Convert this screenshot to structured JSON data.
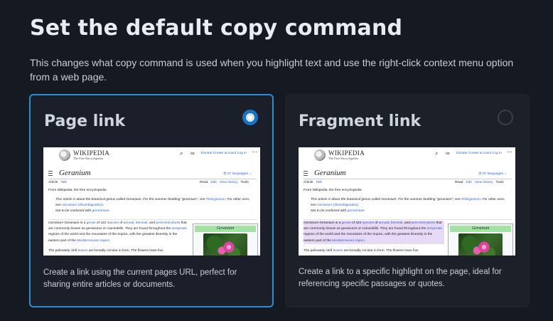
{
  "page": {
    "title": "Set the default copy command",
    "subtitle": "This changes what copy command is used when you highlight text and use the right-click context menu option from a web page."
  },
  "options": [
    {
      "title": "Page link",
      "selected": true,
      "description": "Create a link using the current pages URL, perfect for sharing entire articles or documents."
    },
    {
      "title": "Fragment link",
      "selected": false,
      "description": "Create a link to a specific highlight on the page, ideal for referencing specific passages or quotes."
    }
  ],
  "preview": {
    "wordmark": "WIKIPEDIA",
    "tagline": "The Free Encyclopedia",
    "header_links": "Donate  Create account  Log in",
    "article_title": "Geranium",
    "languages": "67 languages",
    "tab_article": "Article",
    "tab_talk": "Talk",
    "tab_read": "Read",
    "tab_edit": "Edit",
    "tab_history": "View history",
    "tab_tools": "Tools",
    "from_line": "From Wikipedia, the free encyclopedia",
    "hatnote_1": "This article is about the botanical genus called Geranium. For the summer bedding \"geranium\", see",
    "hatnote_1_link": "Pelargonium",
    "hatnote_1_tail": ". For other uses, see",
    "hatnote_1_link2": "Geranium (disambiguation)",
    "hatnote_2": "Not to be confused with",
    "hatnote_2_link": "germanium",
    "para_a": "Geranium is a",
    "para_link1": "genus",
    "para_b": "of 422",
    "para_link2": "species",
    "para_c": "of",
    "para_link3": "annual",
    "para_d": ",",
    "para_link4": "biennial",
    "para_e": ", and",
    "para_link5": "perennial plants",
    "para_f": "that are commonly known as geraniums or cranesbills. They are found throughout the",
    "para_link6": "temperate",
    "para_g": "regions of the world and the mountains of the tropics, with the greatest diversity in the eastern part of the",
    "para_link7": "Mediterranean region",
    "para2_a": "The palmately cleft",
    "para2_link": "leaves",
    "para2_b": "are broadly circular in form. The flowers have five",
    "infobox_title": "Geranium",
    "icon_search": "search-icon",
    "icon_menu": "hamburger-menu-icon"
  }
}
